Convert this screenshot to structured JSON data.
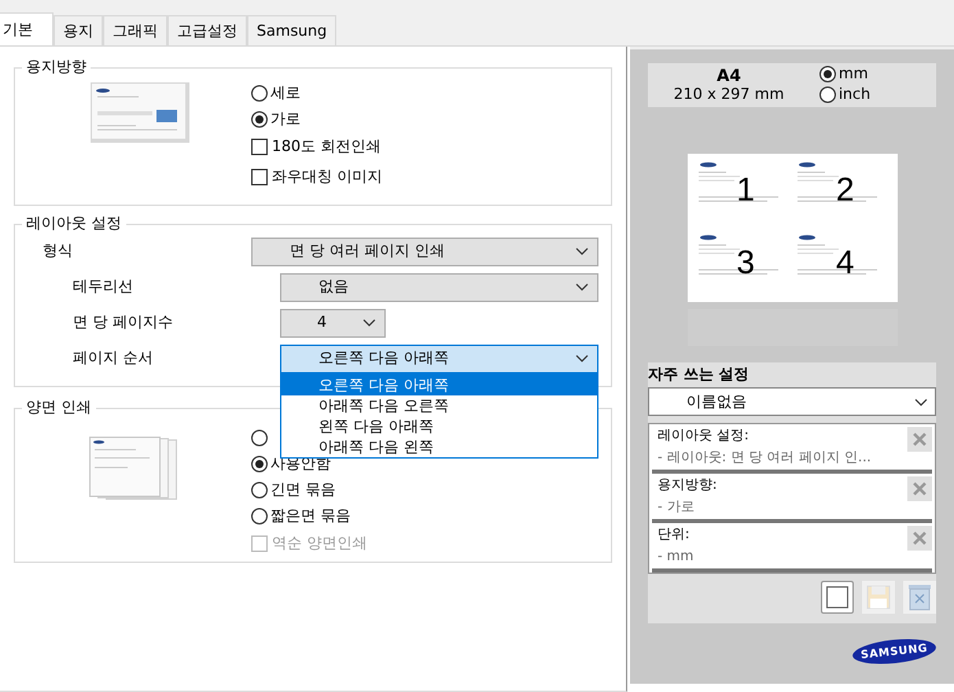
{
  "tabs": [
    {
      "label": "기본",
      "selected": true
    },
    {
      "label": "용지",
      "selected": false
    },
    {
      "label": "그래픽",
      "selected": false
    },
    {
      "label": "고급설정",
      "selected": false
    },
    {
      "label": "Samsung",
      "selected": false
    }
  ],
  "orientation": {
    "title": "용지방향",
    "radios": [
      {
        "label": "세로",
        "selected": false
      },
      {
        "label": "가로",
        "selected": true
      }
    ],
    "checkboxes": [
      {
        "label": "180도 회전인쇄",
        "checked": false
      },
      {
        "label": "좌우대칭 이미지",
        "checked": false
      }
    ]
  },
  "layout": {
    "title": "레이아웃 설정",
    "rows": [
      {
        "label": "형식",
        "value": "면 당 여러 페이지 인쇄",
        "kind": "wide",
        "expanded": false
      },
      {
        "label": "테두리선",
        "value": "없음",
        "kind": "indented",
        "expanded": false
      },
      {
        "label": "면 당 페이지수",
        "value": "4",
        "kind": "narrow",
        "expanded": false
      },
      {
        "label": "페이지 순서",
        "value": "오른쪽 다음 아래쪽",
        "kind": "indented",
        "expanded": true
      }
    ],
    "options": [
      {
        "label": "오른쪽 다음 아래쪽",
        "selected": true
      },
      {
        "label": "아래쪽 다음 오른쪽",
        "selected": false
      },
      {
        "label": "왼쪽 다음 아래쪽",
        "selected": false
      },
      {
        "label": "아래쪽 다음 왼쪽",
        "selected": false
      }
    ]
  },
  "duplex": {
    "title": "양면 인쇄",
    "radios": [
      {
        "selected": false
      },
      {
        "label": "사용안함",
        "selected": true
      },
      {
        "label": "긴면 묶음",
        "selected": false
      },
      {
        "label": "짧은면 묶음",
        "selected": false
      }
    ],
    "checkbox": {
      "label": "역순 양면인쇄",
      "checked": false,
      "disabled": true
    }
  },
  "paper": {
    "name": "A4",
    "size": "210 x 297 mm",
    "units": [
      {
        "label": "mm",
        "selected": true
      },
      {
        "label": "inch",
        "selected": false
      }
    ]
  },
  "preview": {
    "pages": [
      "1",
      "2",
      "3",
      "4"
    ]
  },
  "favorites": {
    "title": "자주 쓰는 설정",
    "value": "이름없음",
    "items": [
      {
        "title": "레이아웃 설정:",
        "detail": "- 레이아웃: 면 당 여러 페이지 인..."
      },
      {
        "title": "용지방향:",
        "detail": "- 가로"
      },
      {
        "title": "단위:",
        "detail": "- mm"
      }
    ]
  },
  "logo": "SAMSUNG"
}
